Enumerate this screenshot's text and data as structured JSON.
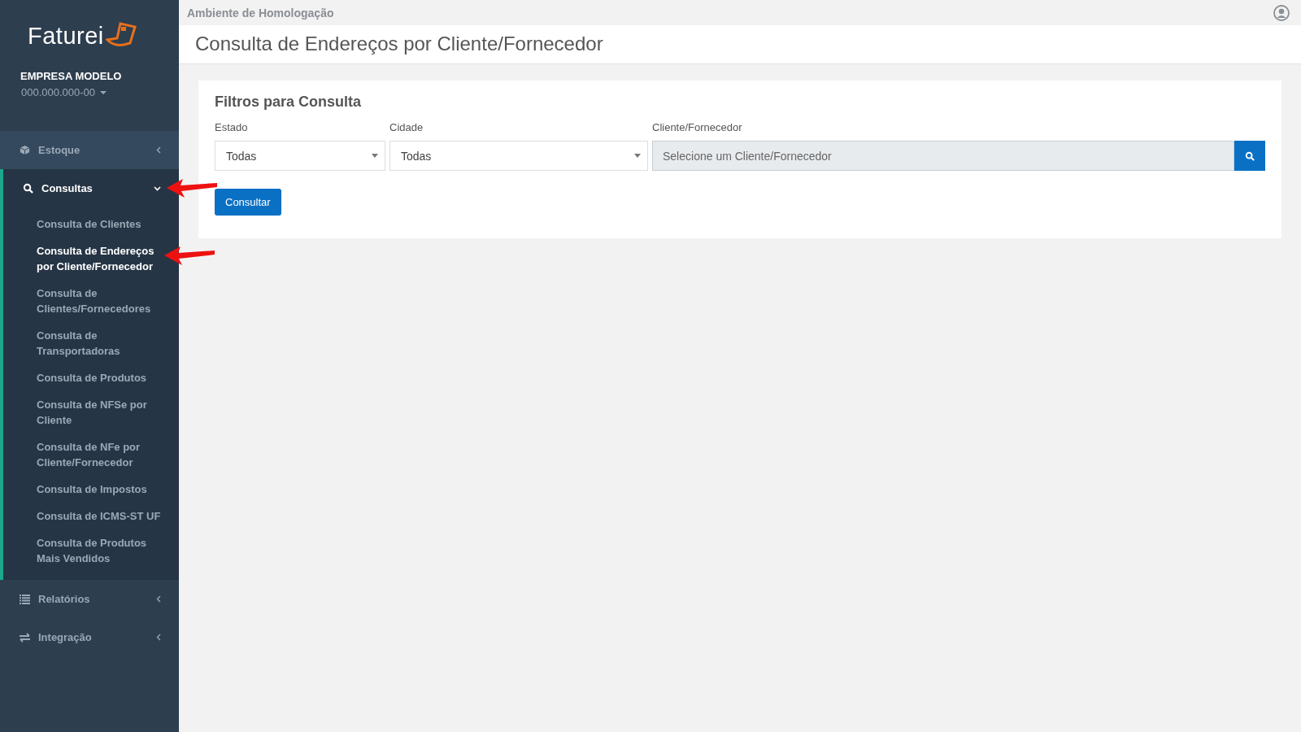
{
  "environment": "Ambiente de Homologação",
  "page_title": "Consulta de Endereços por Cliente/Fornecedor",
  "sidebar": {
    "logo": "Faturei",
    "company": "EMPRESA MODELO",
    "document": "000.000.000-00",
    "menu": [
      {
        "label": "Estoque",
        "expanded": false,
        "hovered": true
      },
      {
        "label": "Consultas",
        "expanded": true,
        "hovered": false,
        "children": [
          {
            "label": "Consulta de Clientes",
            "selected": false
          },
          {
            "label": "Consulta de Endereços por Cliente/Fornecedor",
            "selected": true
          },
          {
            "label": "Consulta de Clientes/Fornecedores",
            "selected": false
          },
          {
            "label": "Consulta de Transportadoras",
            "selected": false
          },
          {
            "label": "Consulta de Produtos",
            "selected": false
          },
          {
            "label": "Consulta de NFSe por Cliente",
            "selected": false
          },
          {
            "label": "Consulta de NFe por Cliente/Fornecedor",
            "selected": false
          },
          {
            "label": "Consulta de Impostos",
            "selected": false
          },
          {
            "label": "Consulta de ICMS-ST UF",
            "selected": false
          },
          {
            "label": "Consulta de Produtos Mais Vendidos",
            "selected": false
          }
        ]
      },
      {
        "label": "Relatórios",
        "expanded": false,
        "hovered": false
      },
      {
        "label": "Integração",
        "expanded": false,
        "hovered": false
      }
    ]
  },
  "filters": {
    "title": "Filtros para Consulta",
    "fields": [
      {
        "kind": "select",
        "label": "Estado",
        "value": "Todas"
      },
      {
        "kind": "select",
        "label": "Cidade",
        "value": "Todas"
      },
      {
        "kind": "search",
        "label": "Cliente/Fornecedor",
        "placeholder": "Selecione um Cliente/Fornecedor"
      }
    ],
    "submit": "Consultar"
  }
}
